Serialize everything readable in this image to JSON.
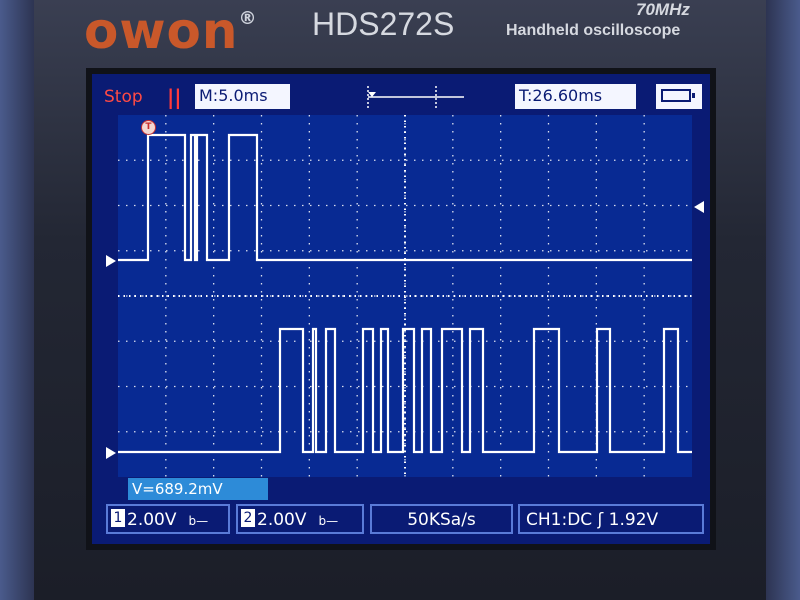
{
  "device": {
    "brand": "owon",
    "registered": "®",
    "model": "HDS272S",
    "bandwidth": "70MHz",
    "subtitle": "Handheld oscilloscope"
  },
  "status_bar": {
    "run_state": "Stop",
    "pause_glyph": "||",
    "timebase": "M:5.0ms",
    "trigger_time": "T:26.60ms",
    "battery_icon": "battery-icon"
  },
  "waveform": {
    "trigger_marker": "T",
    "cursor_readout": "V=689.2mV"
  },
  "bottom_bar": {
    "ch1_number": "1",
    "ch1_scale": "2.00V",
    "ch1_coupling_glyph": "b—",
    "ch2_number": "2",
    "ch2_scale": "2.00V",
    "ch2_coupling_glyph": "b—",
    "sample_rate": "50KSa/s",
    "trigger_info": "CH1:DC ʃ 1.92V"
  },
  "colors": {
    "screen_bg": "#0a1b74",
    "plot_bg": "#082a93",
    "grid": "#ffffff",
    "trace": "#ffffff",
    "stop_text": "#ff4a44",
    "readout_bg": "#2d8bd8",
    "brand": "#c9582a"
  }
}
